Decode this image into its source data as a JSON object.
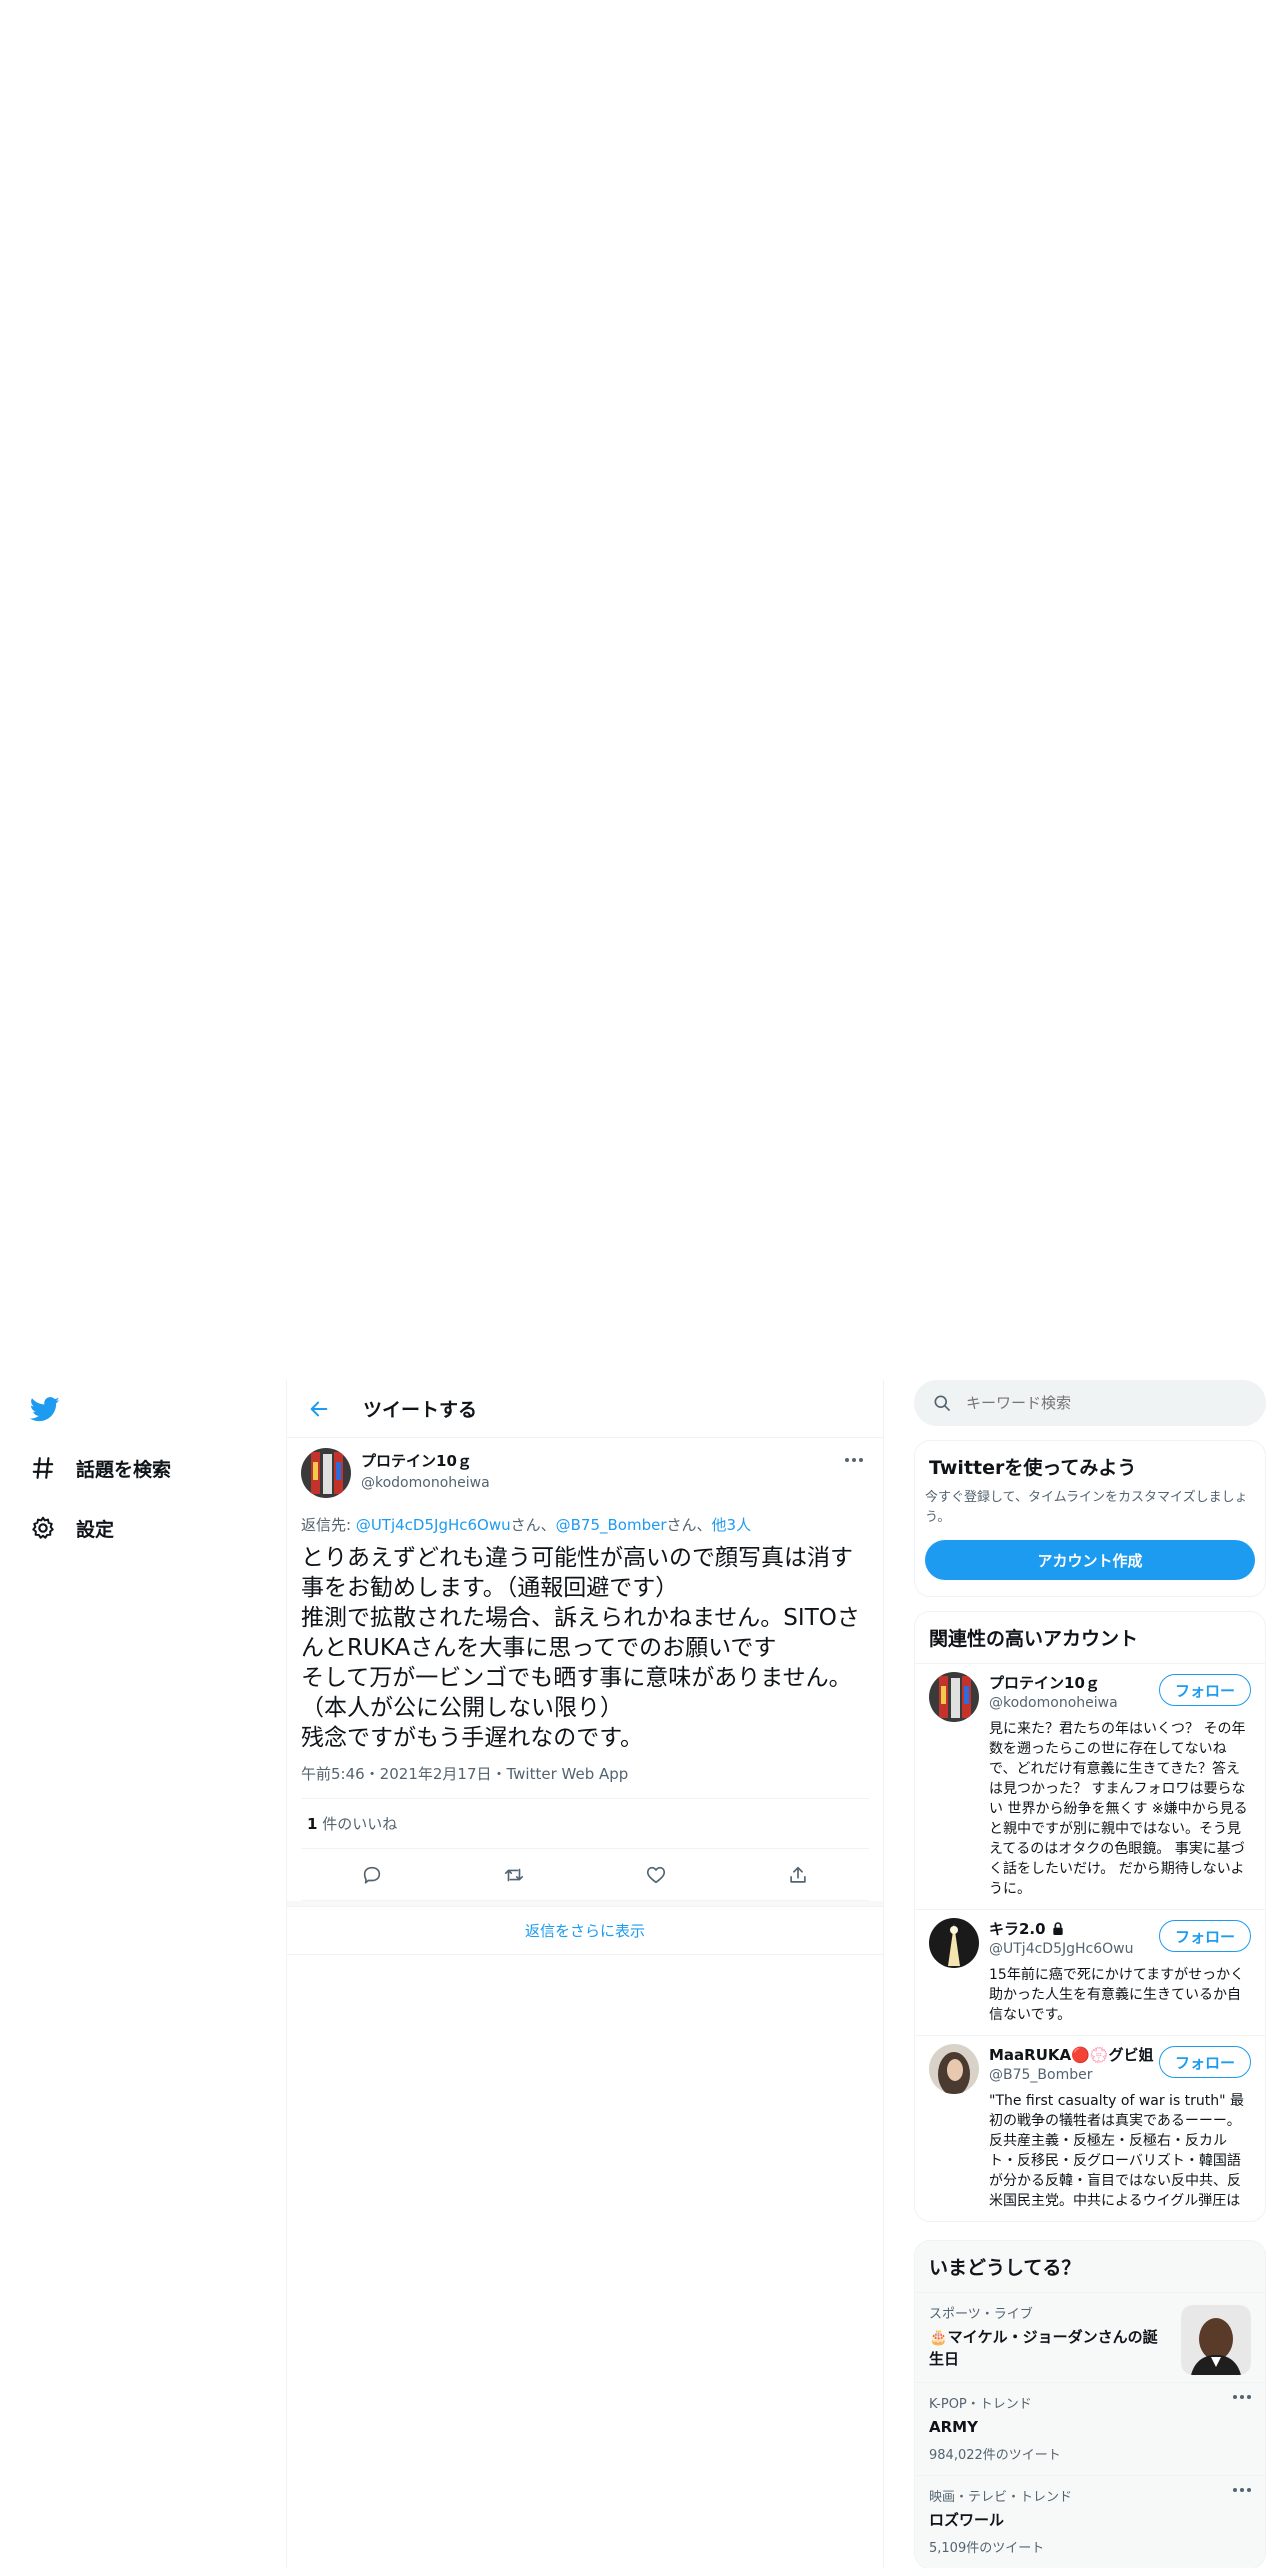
{
  "nav": {
    "logo_icon": "twitter-bird-icon",
    "items": [
      {
        "label": "話題を検索",
        "icon": "hashtag-icon"
      },
      {
        "label": "設定",
        "icon": "gear-icon"
      }
    ]
  },
  "header": {
    "title": "ツイートする",
    "back_icon": "arrow-left-icon"
  },
  "tweet": {
    "author_name": "プロテイン10ｇ",
    "author_handle": "@kodomonoheiwa",
    "reply_prefix": "返信先: ",
    "reply_mention1": "@UTj4cD5JgHc6Owu",
    "reply_sep1": "さん、",
    "reply_mention2": "@B75_Bomber",
    "reply_sep2": "さん、",
    "reply_others": "他3人",
    "text": "とりあえずどれも違う可能性が高いので顔写真は消す事をお勧めします。（通報回避です）\n推測で拡散された場合、訴えられかねません。SITOさんとRUKAさんを大事に思ってでのお願いです\nそして万が一ビンゴでも晒す事に意味がありません。\n（本人が公に公開しない限り）\n残念ですがもう手遅れなのです。",
    "meta": "午前5:46・2021年2月17日・Twitter Web App",
    "like_count": "1",
    "like_label": " 件のいいね",
    "more_replies": "返信をさらに表示"
  },
  "right": {
    "search_placeholder": "キーワード検索",
    "try": {
      "title": "Twitterを使ってみよう",
      "desc": "今すぐ登録して、タイムラインをカスタマイズしましょう。",
      "button": "アカウント作成"
    },
    "related": {
      "title": "関連性の高いアカウント",
      "follow_label": "フォロー",
      "accounts": [
        {
          "name": "プロテイン10ｇ",
          "handle": "@kodomonoheiwa",
          "bio": "見に来た？君たちの年はいくつ？ その年数を遡ったらこの世に存在してないね で、どれだけ有意義に生きてきた？答えは見つかった？ すまんフォロワは要らない 世界から紛争を無くす ※嫌中から見ると親中ですが別に親中ではない。そう見えてるのはオタクの色眼鏡。 事実に基づく話をしたいだけ。 だから期待しないように。"
        },
        {
          "name": "キラ2.0",
          "handle": "@UTj4cD5JgHc6Owu",
          "bio": "15年前に癌で死にかけてますがせっかく助かった人生を有意義に生きているか自信ないです。"
        },
        {
          "name": "MaaRUKA🔴💮グビ姐",
          "handle": "@B75_Bomber",
          "bio": "\"The first casualty of war is truth\" 最初の戦争の犠牲者は真実であるーーー。反共産主義・反極左・反極右・反カルト・反移民・反グローバリズト・韓国語が分かる反韓・盲目ではない反中共、反米国民主党。中共によるウイグル弾圧は事実だけど印象操作が酷い"
        }
      ]
    },
    "trends": {
      "title": "いまどうしてる？",
      "items": [
        {
          "category": "スポーツ・ライブ",
          "name": "🎂マイケル・ジョーダンさんの誕生日",
          "count": ""
        },
        {
          "category": "K-POP・トレンド",
          "name": "ARMY",
          "count": "984,022件のツイート"
        },
        {
          "category": "映画・テレビ・トレンド",
          "name": "ロズワール",
          "count": "5,109件のツイート"
        }
      ]
    }
  },
  "colors": {
    "accent": "#1d9bf0",
    "text": "#0f1419",
    "muted": "#536471",
    "border": "#eff3f4"
  }
}
